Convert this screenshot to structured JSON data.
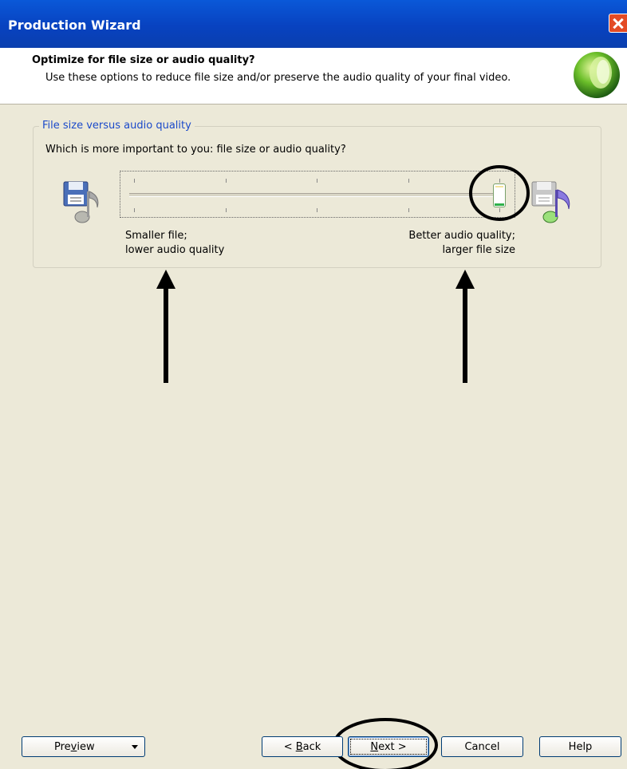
{
  "window": {
    "title": "Production Wizard"
  },
  "header": {
    "title": "Optimize for file size or audio quality?",
    "subtitle": "Use these options to reduce file size and/or preserve the audio quality of your final video."
  },
  "group": {
    "legend": "File size versus audio quality",
    "question": "Which is more important to you: file size or audio quality?",
    "slider": {
      "value_fraction": 1.0,
      "tick_count": 5
    },
    "left_label_line1": "Smaller file;",
    "left_label_line2": "lower audio quality",
    "right_label_line1": "Better audio quality;",
    "right_label_line2": "larger file size"
  },
  "buttons": {
    "preview_pre": "Pre",
    "preview_u": "v",
    "preview_post": "iew",
    "back_pre": "< ",
    "back_u": "B",
    "back_post": "ack",
    "next_u": "N",
    "next_post": "ext >",
    "cancel": "Cancel",
    "help": "Help"
  },
  "colors": {
    "titlebar": "#0842c0",
    "legend": "#1b4aca",
    "background": "#ece9d8"
  }
}
